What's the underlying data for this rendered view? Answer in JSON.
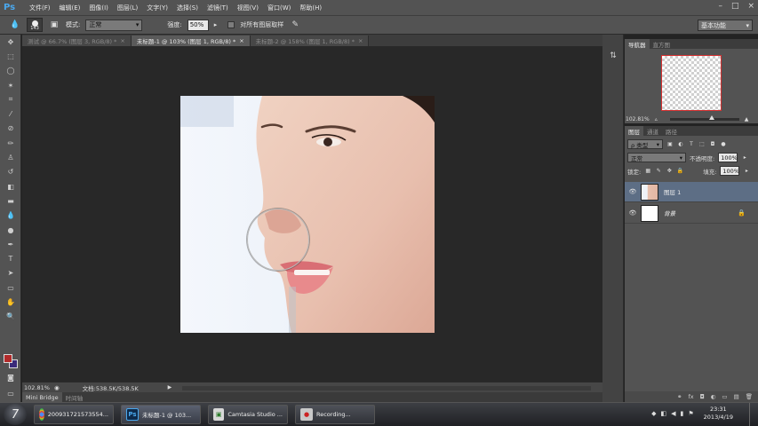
{
  "menu": {
    "logo": "Ps",
    "items": [
      "文件(F)",
      "编辑(E)",
      "图像(I)",
      "图层(L)",
      "文字(Y)",
      "选择(S)",
      "滤镜(T)",
      "视图(V)",
      "窗口(W)",
      "帮助(H)"
    ],
    "window_buttons": [
      "–",
      "□",
      "×"
    ]
  },
  "options": {
    "brush_size": "143",
    "mode_label": "模式:",
    "mode_value": "正常",
    "strength_label": "强度:",
    "strength_value": "50%",
    "sample_all_label": "对所有图层取样",
    "workspace": "基本功能"
  },
  "tabs": [
    {
      "label": "测试 @ 66.7% (图层 3, RGB/8) *",
      "close": "×"
    },
    {
      "label": "未标题-1 @ 103% (图层 1, RGB/8) *",
      "close": "×"
    },
    {
      "label": "未标题-2 @ 158% (图层 1, RGB/8) *",
      "close": "×"
    }
  ],
  "status": {
    "zoom": "102.81%",
    "doc_info": "文档:538.5K/538.5K",
    "arrow": "▶"
  },
  "minibridge": {
    "tab1": "Mini Bridge",
    "tab2": "时间轴"
  },
  "navigator": {
    "tab1": "导航器",
    "tab2": "直方图",
    "zoom": "102.81%"
  },
  "layers": {
    "tabs": [
      "图层",
      "通道",
      "路径"
    ],
    "kind_label": "ρ 类型",
    "blend_mode": "正常",
    "opacity_label": "不透明度:",
    "opacity_value": "100%",
    "lock_label": "锁定:",
    "fill_label": "填充:",
    "fill_value": "100%",
    "items": [
      {
        "name": "图层 1",
        "selected": true
      },
      {
        "name": "背景",
        "selected": false
      }
    ],
    "footer_icons": [
      "fx",
      "◘",
      "◐",
      "▭",
      "▤",
      "🗑"
    ]
  },
  "taskbar": {
    "start": "7",
    "tasks": [
      {
        "label": "20093172157355​4...",
        "icon": "chrome"
      },
      {
        "label": "未标题-1 @ 103...",
        "icon": "ps"
      },
      {
        "label": "Camtasia Studio ...",
        "icon": "camtasia"
      },
      {
        "label": "Recording...",
        "icon": "rec"
      }
    ],
    "time": "23:31",
    "date": "2013/4/19"
  },
  "colors": {
    "foreground": "#b22a2a",
    "background": "#3a2a7a",
    "selected_layer": "#5d6e85"
  }
}
